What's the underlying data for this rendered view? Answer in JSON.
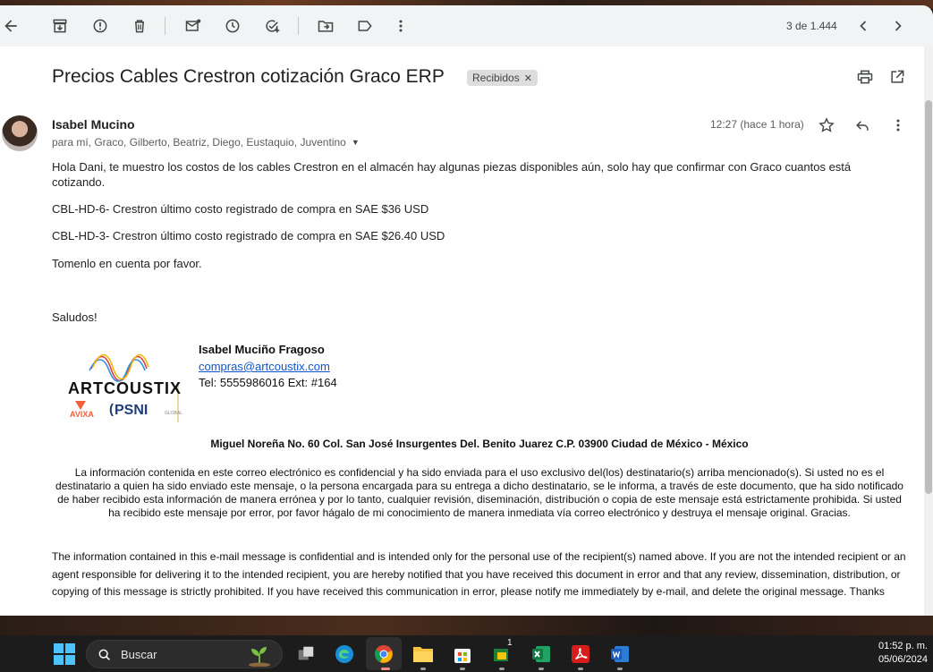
{
  "toolbar": {
    "counter": "3 de 1.444"
  },
  "email": {
    "subject": "Precios Cables Crestron cotización Graco ERP",
    "label": "Recibidos",
    "sender": "Isabel Mucino",
    "recipients": "para mí, Graco, Gilberto, Beatriz, Diego, Eustaquio, Juventino",
    "time": "12:27 (hace 1 hora)",
    "body": {
      "p1": "Hola Dani, te muestro los costos de los cables Crestron en el almacén hay algunas piezas disponibles aún, solo hay que confirmar con Graco cuantos está cotizando.",
      "p2": "CBL-HD-6- Crestron  último costo registrado de compra en SAE $36 USD",
      "p3": "CBL-HD-3- Crestron  último costo registrado de compra en SAE $26.40 USD",
      "p4": "Tomenlo en cuenta por favor.",
      "p5": "Saludos!"
    },
    "signature": {
      "name": "Isabel Muciño Fragoso",
      "email": "compras@artcoustix.com",
      "tel": "Tel: 5555986016 Ext: #164",
      "logo_text": "ARTCOUSTIX",
      "logo_sub1": "AVIXA",
      "logo_sub2": "PSNI"
    },
    "address": "Miguel Noreña No. 60 Col. San José Insurgentes Del. Benito Juarez C.P. 03900 Ciudad de México - México",
    "disclaimer_es": "La información contenida en este correo electrónico es confidencial y ha sido enviada para el uso exclusivo del(los) destinatario(s) arriba mencionado(s). Si usted no es el destinatario a quien ha sido enviado este mensaje, o la persona encargada para su entrega a dicho destinatario, se le informa, a través de este documento, que ha sido notificado de haber recibido esta información de manera errónea y por lo tanto, cualquier revisión, diseminación, distribución o copia de este mensaje está estrictamente prohibida. Si usted ha recibido este mensaje por error, por favor hágalo de mi conocimiento de manera inmediata vía correo electrónico y destruya el mensaje original. Gracias.",
    "disclaimer_en": "The information contained in this e-mail message is confidential and is intended only for the personal use of the recipient(s) named above. If you are not the intended recipient or an agent responsible for delivering it to the intended recipient, you are hereby notified that you have received this document in error and that any review, dissemination, distribution, or copying of this message is strictly prohibited. If you have received this communication in error, please notify me immediately by e-mail, and delete the original message. Thanks"
  },
  "taskbar": {
    "search_placeholder": "Buscar",
    "time": "01:52 p. m.",
    "date": "05/06/2024",
    "store_badge": "1"
  },
  "colors": {
    "accent": "#1155cc",
    "toolbar_bg": "#f1f3f4",
    "taskbar_bg": "#1c1c1c"
  }
}
